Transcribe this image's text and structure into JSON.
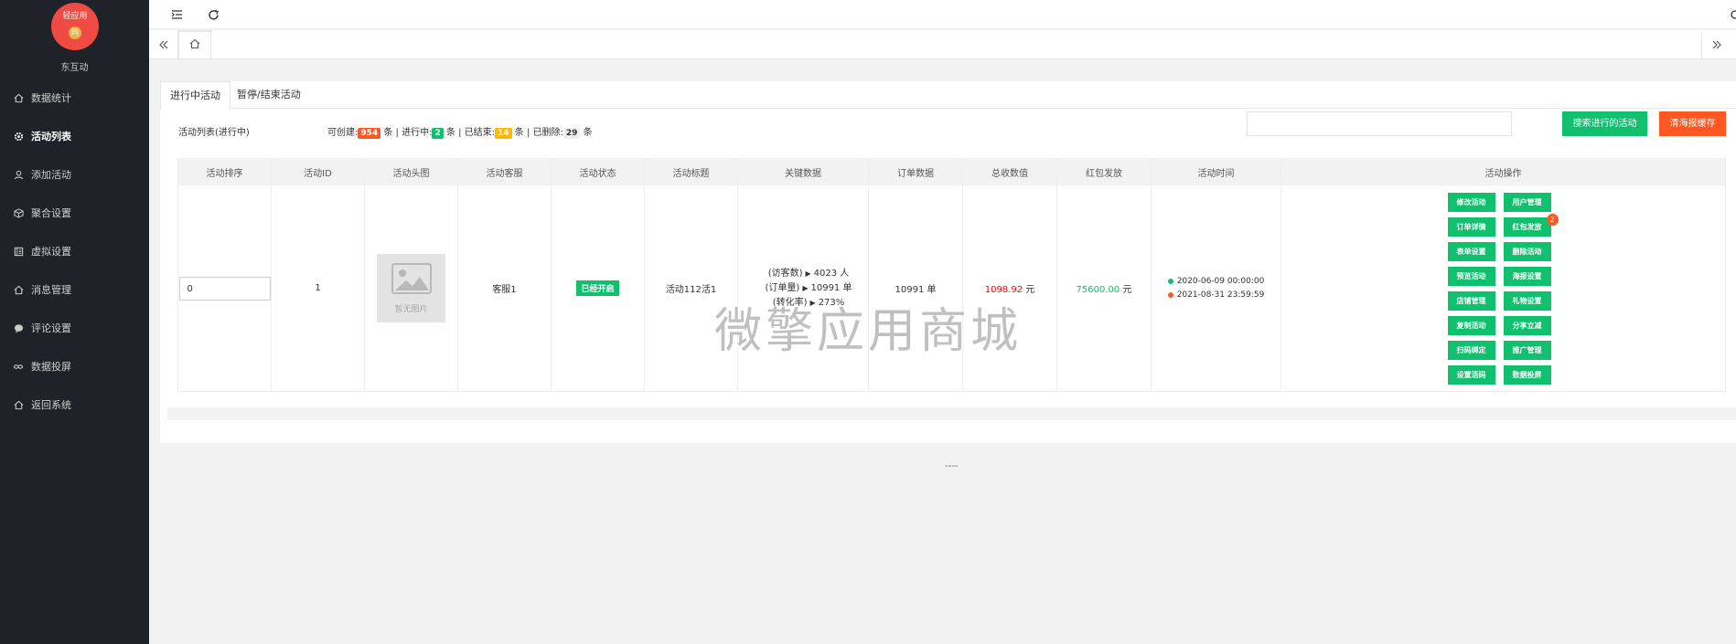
{
  "sidebar": {
    "logo_text": "轻应用",
    "logo_badge": "同",
    "brand_name": "东互动",
    "items": [
      {
        "label": "数据统计",
        "icon": "home-icon"
      },
      {
        "label": "活动列表",
        "icon": "gear-icon",
        "active": true
      },
      {
        "label": "添加活动",
        "icon": "user-icon"
      },
      {
        "label": "聚合设置",
        "icon": "cube-icon"
      },
      {
        "label": "虚拟设置",
        "icon": "book-icon"
      },
      {
        "label": "消息管理",
        "icon": "home-icon"
      },
      {
        "label": "评论设置",
        "icon": "chat-icon"
      },
      {
        "label": "数据投屏",
        "icon": "link-icon"
      },
      {
        "label": "返回系统",
        "icon": "home-icon"
      }
    ]
  },
  "topbar": {
    "icons": [
      "menu-fold-icon",
      "refresh-icon"
    ]
  },
  "tabs": {
    "items": [
      "进行中活动",
      "暂停/结束活动"
    ]
  },
  "list": {
    "title": "活动列表(进行中)",
    "stats": {
      "creatable_label": "可创建:",
      "creatable": "954",
      "ongoing_label": "进行中:",
      "ongoing": "2",
      "ended_label": "已结束:",
      "ended": "14",
      "deleted_label": "已删除:",
      "deleted": "29",
      "unit": "条",
      "sep": "|"
    }
  },
  "search": {
    "placeholder": "",
    "button": "搜索进行的活动",
    "clear_button": "清海报缓存"
  },
  "table": {
    "headers": [
      "活动排序",
      "活动ID",
      "活动头图",
      "活动客服",
      "活动状态",
      "活动标题",
      "关键数据",
      "订单数据",
      "总收数值",
      "红包发放",
      "活动时间",
      "活动操作"
    ],
    "row": {
      "sort_value": "0",
      "id": "1",
      "image_placeholder": "暂无图片",
      "service": "客服1",
      "status": "已经开启",
      "title": "活动112活1",
      "key_data": [
        {
          "label": "(访客数)",
          "value": "4023 人"
        },
        {
          "label": "(订单量)",
          "value": "10991 单"
        },
        {
          "label": "(转化率)",
          "value": "273%"
        }
      ],
      "orders": "10991 单",
      "total_amount": "1098.92",
      "total_unit": "元",
      "redpacket_amount": "75600.00",
      "redpacket_unit": "元",
      "start_time": "2020-06-09 00:00:00",
      "end_time": "2021-08-31 23:59:59",
      "operations": [
        {
          "label": "修改活动"
        },
        {
          "label": "用户管理"
        },
        {
          "label": "订单详情"
        },
        {
          "label": "红包发放",
          "badge": "2"
        },
        {
          "label": "表单设置"
        },
        {
          "label": "删除活动"
        },
        {
          "label": "预览活动"
        },
        {
          "label": "海报设置"
        },
        {
          "label": "店铺管理"
        },
        {
          "label": "礼物设置"
        },
        {
          "label": "复制活动"
        },
        {
          "label": "分享立减"
        },
        {
          "label": "扫码绑定"
        },
        {
          "label": "推广管理"
        },
        {
          "label": "设置活码"
        },
        {
          "label": "数据投屏"
        }
      ]
    }
  },
  "footer": {
    "text": "----"
  },
  "watermark": "微擎应用商城",
  "colors": {
    "sidebar_bg": "#20222a",
    "green": "#10c06f",
    "orange": "#ff5722",
    "red": "#ff0000",
    "logo_red": "#ef4b43"
  }
}
